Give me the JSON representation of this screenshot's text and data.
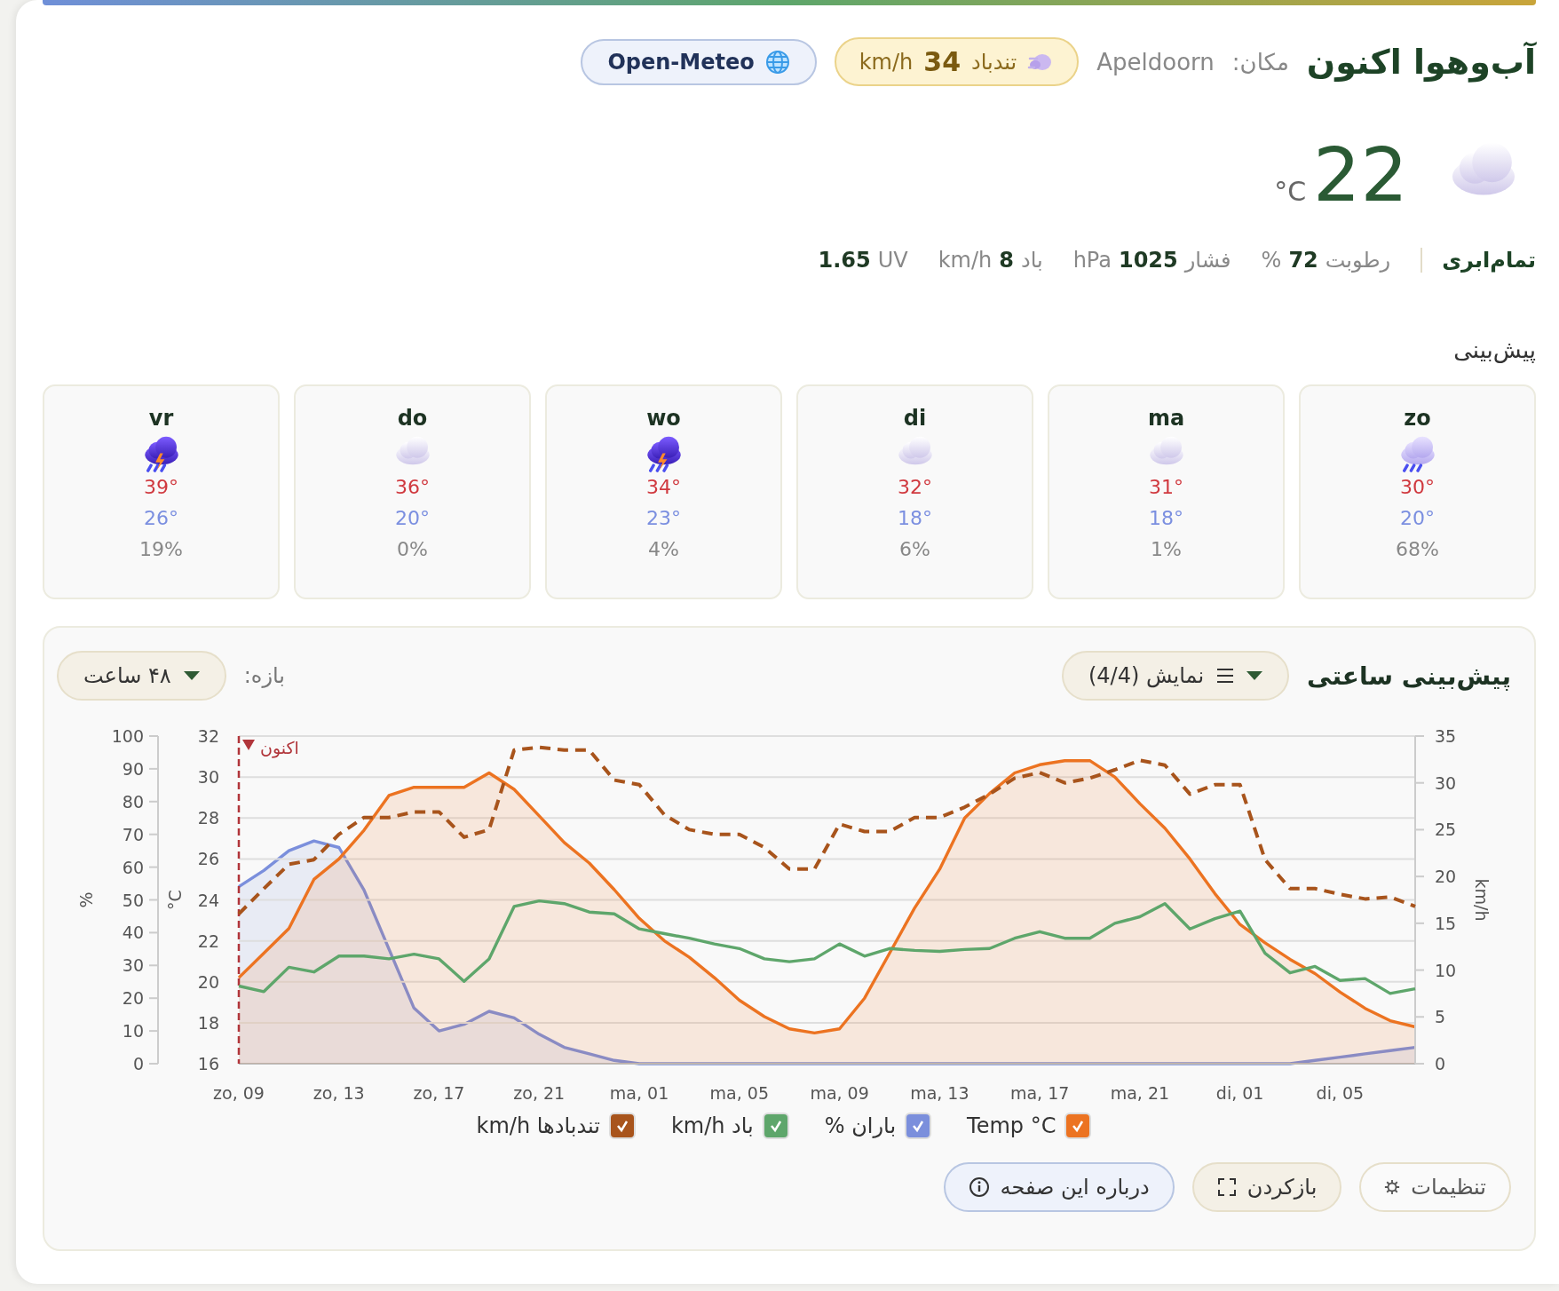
{
  "header": {
    "title": "آب‌وهوا اکنون",
    "location_label": "مکان:",
    "location": "Apeldoorn",
    "gust_badge": {
      "label": "تندباد",
      "value": "34",
      "unit": "km/h"
    },
    "source_badge": "Open-Meteo"
  },
  "current": {
    "kind": "cloud",
    "temperature": "22",
    "unit": "°C",
    "condition": "تمام‌ابری",
    "details": [
      {
        "label": "رطوبت",
        "value": "72",
        "unit": "%"
      },
      {
        "label": "فشار",
        "value": "1025",
        "unit": "hPa"
      },
      {
        "label": "باد",
        "value": "8",
        "unit": "km/h"
      },
      {
        "label": "UV",
        "value": "1.65"
      }
    ]
  },
  "forecast": {
    "title": "پیش‌بینی",
    "days": [
      {
        "day": "zo",
        "kind": "rain",
        "high": "30°",
        "low": "20°",
        "precipitation": "68%"
      },
      {
        "day": "ma",
        "kind": "cloud",
        "high": "31°",
        "low": "18°",
        "precipitation": "1%"
      },
      {
        "day": "di",
        "kind": "cloud",
        "high": "32°",
        "low": "18°",
        "precipitation": "6%"
      },
      {
        "day": "wo",
        "kind": "storm",
        "high": "34°",
        "low": "23°",
        "precipitation": "4%"
      },
      {
        "day": "do",
        "kind": "cloud",
        "high": "36°",
        "low": "20°",
        "precipitation": "0%"
      },
      {
        "day": "vr",
        "kind": "storm",
        "high": "39°",
        "low": "26°",
        "precipitation": "19%"
      }
    ]
  },
  "hourly": {
    "title": "پیش‌بینی ساعتی",
    "series_menu": "نمایش (4/4)",
    "range_label": "بازه:",
    "range": "۴۸ ساعت",
    "temperature_chart": {
      "chart_data": {
        "type": "area",
        "ylabel": "°C",
        "ylim": [
          16,
          32
        ],
        "yticks": [
          16,
          18,
          20,
          22,
          24,
          26,
          28,
          30,
          32
        ],
        "categories": [
          "zo, 09",
          null,
          null,
          null,
          "zo, 13",
          null,
          null,
          null,
          "zo, 17",
          null,
          null,
          null,
          "zo, 21",
          null,
          null,
          null,
          "ma, 01",
          null,
          null,
          null,
          "ma, 05",
          null,
          null,
          null,
          "ma, 09",
          null,
          null,
          null,
          "ma, 13",
          null,
          null,
          null,
          "ma, 17",
          null,
          null,
          null,
          "ma, 21",
          null,
          null,
          null,
          "di, 01",
          null,
          null,
          null,
          "di, 05",
          null,
          null,
          null
        ],
        "grid": true,
        "annotations": [
          "اکنون"
        ],
        "series": [
          {
            "color": "#ec7321",
            "values": [
              20.2,
              21.4,
              22.6,
              25,
              26,
              27.4,
              29.1,
              29.5,
              29.5,
              29.5,
              30.2,
              29.4,
              28.1,
              26.8,
              25.8,
              24.5,
              23.1,
              22,
              21.2,
              20.2,
              19.1,
              18.3,
              17.7,
              17.5,
              17.7,
              19.2,
              21.4,
              23.6,
              25.5,
              28,
              29.2,
              30.2,
              30.6,
              30.8,
              30.8,
              30,
              28.7,
              27.5,
              26,
              24.3,
              22.8,
              21.9,
              21.1,
              20.4,
              19.5,
              18.7,
              18.1,
              17.8
            ]
          }
        ]
      }
    },
    "rain_chart": {
      "chart_data": {
        "type": "area",
        "ylabel": "%",
        "ylim": [
          0,
          100
        ],
        "yticks": [
          0,
          10,
          20,
          30,
          40,
          50,
          60,
          70,
          80,
          90,
          100
        ],
        "categories": [
          null,
          null,
          null,
          null,
          null,
          null,
          null,
          null,
          null,
          null,
          null,
          null,
          null,
          null,
          null,
          null,
          null,
          null,
          null,
          null,
          null,
          null,
          null,
          null,
          null,
          null,
          null,
          null,
          null,
          null,
          null,
          null,
          null,
          null,
          null,
          null,
          null,
          null,
          null,
          null,
          null,
          null,
          null,
          null,
          null,
          null,
          null,
          null
        ],
        "series": [
          {
            "color": "#7b8fdc",
            "values": [
              54,
              59,
              65,
              68,
              66,
              53,
              35,
              17,
              10,
              12,
              16,
              14,
              9,
              5,
              3,
              1,
              0,
              0,
              0,
              0,
              0,
              0,
              0,
              0,
              0,
              0,
              0,
              0,
              0,
              0,
              0,
              0,
              0,
              0,
              0,
              0,
              0,
              0,
              0,
              0,
              0,
              0,
              0,
              1,
              2,
              3,
              4,
              5
            ]
          }
        ]
      }
    },
    "wind_chart": {
      "chart_data": {
        "type": "line",
        "ylabel": "km/h",
        "ylim": [
          0,
          35
        ],
        "yticks": [
          0,
          5,
          10,
          15,
          20,
          25,
          30,
          35
        ],
        "categories": [
          null,
          null,
          null,
          null,
          null,
          null,
          null,
          null,
          null,
          null,
          null,
          null,
          null,
          null,
          null,
          null,
          null,
          null,
          null,
          null,
          null,
          null,
          null,
          null,
          null,
          null,
          null,
          null,
          null,
          null,
          null,
          null,
          null,
          null,
          null,
          null,
          null,
          null,
          null,
          null,
          null,
          null,
          null,
          null,
          null,
          null,
          null,
          null
        ],
        "series": [
          {
            "color": "#5ea66b",
            "line_style": "solid",
            "values": [
              8.3,
              7.7,
              10.3,
              9.8,
              11.5,
              11.5,
              11.2,
              11.7,
              11.2,
              8.8,
              11.2,
              16.8,
              17.4,
              17.1,
              16.2,
              16,
              14.4,
              13.9,
              13.4,
              12.8,
              12.3,
              11.2,
              10.9,
              11.2,
              12.8,
              11.5,
              12.3,
              12.1,
              12,
              12.2,
              12.3,
              13.4,
              14.1,
              13.4,
              13.4,
              15,
              15.7,
              17.1,
              14.4,
              15.5,
              16.3,
              11.8,
              9.7,
              10.4,
              8.9,
              9.1,
              7.5,
              8
            ]
          },
          {
            "color": "#a8541c",
            "line_style": "dashed",
            "values": [
              16,
              18.7,
              21.3,
              21.8,
              24.5,
              26.3,
              26.3,
              26.9,
              26.9,
              24.2,
              25,
              33.5,
              33.8,
              33.5,
              33.5,
              30.3,
              29.8,
              26.6,
              25,
              24.5,
              24.5,
              23.1,
              20.8,
              20.8,
              25.6,
              24.8,
              24.8,
              26.3,
              26.3,
              27.4,
              28.8,
              30.5,
              31.1,
              30,
              30.5,
              31.4,
              32.4,
              31.9,
              28.8,
              29.8,
              29.8,
              21.8,
              18.7,
              18.7,
              18.1,
              17.6,
              17.8,
              16.8
            ]
          }
        ]
      }
    },
    "legend": [
      {
        "label": "Temp °C",
        "checked": true,
        "color": "#ec7321"
      },
      {
        "label": "باران %",
        "checked": true,
        "color": "#7b8fdc"
      },
      {
        "label": "باد km/h",
        "checked": true,
        "color": "#5ea66b"
      },
      {
        "label": "تندبادها km/h",
        "checked": true,
        "color": "#a8541c"
      }
    ],
    "buttons": [
      {
        "label": "تنظیمات",
        "kind": "settings"
      },
      {
        "label": "بازکردن",
        "kind": "expand"
      },
      {
        "label": "درباره این صفحه",
        "kind": "info"
      }
    ]
  }
}
